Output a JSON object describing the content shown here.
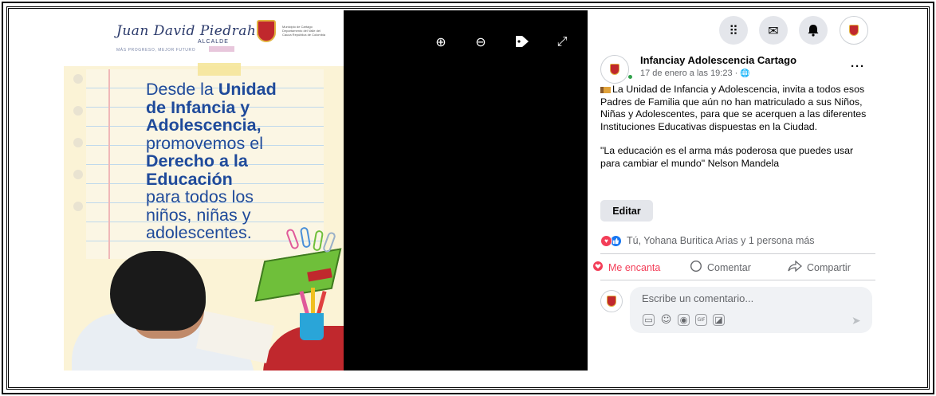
{
  "photo": {
    "signature": "Juan David Piedrahita",
    "alcalde": "ALCALDE",
    "slogan": "MÁS PROGRESO, MEJOR FUTURO",
    "shield_caption": "Municipio de Cartago Departamento del Valle del Cauca República de Colombia",
    "lines": [
      {
        "t": "Desde la ",
        "b": "Unidad"
      },
      {
        "t": "",
        "b": "de Infancia y"
      },
      {
        "t": "",
        "b": "Adolescencia,"
      },
      {
        "t": "promovemos el",
        "b": ""
      },
      {
        "t": "",
        "b": "Derecho a la"
      },
      {
        "t": "",
        "b": "Educación"
      },
      {
        "t": "para todos los",
        "b": ""
      },
      {
        "t": "niños, niñas y",
        "b": ""
      },
      {
        "t": "adolescentes.",
        "b": ""
      }
    ]
  },
  "viewer": {
    "zoom_in": "⊕",
    "zoom_out": "⊖",
    "tag": "●",
    "fullscreen": "⤢"
  },
  "topbar": {
    "menu_icon": "menu-grid-icon",
    "messenger_icon": "messenger-icon",
    "notifications_icon": "bell-icon",
    "menu_glyph": "⠿",
    "messenger_glyph": "✉",
    "bell_glyph": "🔔"
  },
  "post": {
    "author": "Infanciay Adolescencia Cartago",
    "date": "17 de enero a las 19:23 · ",
    "globe": "🌐",
    "more": "···",
    "paragraph1": "La Unidad de Infancia y Adolescencia, invita a todos esos Padres de Familia que aún no han matriculado a sus Niños, Niñas y Adolescentes, para que se acerquen a las diferentes Instituciones Educativas dispuestas en la Ciudad.",
    "paragraph2": "\"La educación es el arma más poderosa que puedes usar para cambiar el mundo\" Nelson Mandela",
    "edit_label": "Editar",
    "reactions_text": "Tú, Yohana Buritica Arias y 1 persona más",
    "love_glyph": "♥",
    "like_glyph": "👍"
  },
  "actions": {
    "like_label": "Me encanta",
    "comment_label": "Comentar",
    "share_label": "Compartir",
    "like_glyph": "♥",
    "comment_glyph": "◯",
    "share_glyph": "➦"
  },
  "comment": {
    "placeholder": "Escribe un comentario...",
    "icons": [
      "▭",
      "☺",
      "◉",
      "GIF",
      "◪"
    ],
    "send": "➤"
  },
  "colors": {
    "facebook_blue": "#1877f2",
    "love_red": "#f33e58",
    "poster_blue": "#1f4a9a",
    "cartago_red": "#c0282d"
  }
}
